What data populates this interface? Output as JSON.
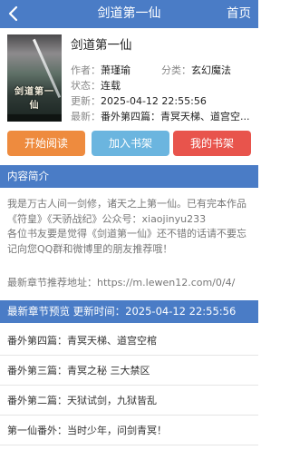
{
  "header": {
    "title": "剑道第一仙",
    "home_label": "首页"
  },
  "book": {
    "cover_title": "剑道第一仙",
    "name": "剑道第一仙",
    "author_label": "作者：",
    "author": "萧瑾瑜",
    "category_label": "分类：",
    "category": "玄幻魔法",
    "status_label": "状态：",
    "status": "连载",
    "updated_label": "更新：",
    "updated": "2025-04-12 22:55:56",
    "latest_label": "最新：",
    "latest": "番外第四篇：青冥天梯、道宫空..."
  },
  "buttons": {
    "read": "开始阅读",
    "add_shelf": "加入书架",
    "my_shelf": "我的书架"
  },
  "intro": {
    "header": "内容简介",
    "line1": "我是万古人间一剑修，诸天之上第一仙。已有完本作品《符皇》《天骄战纪》公众号：xiaojinyu233",
    "line2": "各位书友要是觉得《剑道第一仙》还不错的话请不要忘记向您QQ群和微博里的朋友推荐哦！",
    "latest_addr": "最新章节推荐地址：https://m.lewen12.com/0/4/"
  },
  "chapters": {
    "header": "最新章节预览 更新时间：2025-04-12 22:55:56",
    "items": [
      "番外第四篇：青冥天梯、道宫空棺",
      "番外第三篇：青冥之秘 三大禁区",
      "番外第二篇：天狱试剑，九狱皆乱",
      "第一仙番外：当时少年，问剑青冥！"
    ]
  },
  "colors": {
    "brand_blue": "#4a7cc6",
    "read_orange": "#ee8b3e",
    "add_blue": "#6bb5df",
    "shelf_red": "#e8544c"
  }
}
